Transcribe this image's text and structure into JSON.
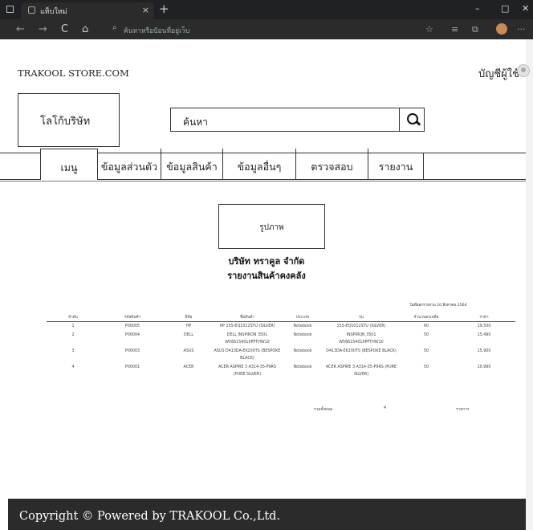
{
  "browser": {
    "tab_title": "แท็บใหม่",
    "tab_close": "×",
    "new_tab": "+",
    "address_placeholder": "ค้นหาหรือป้อนที่อยู่เว็บ",
    "controls": {
      "minimize": "–",
      "maximize": "□",
      "close": "✕"
    },
    "nav": {
      "back": "←",
      "forward": "→",
      "reload": "C",
      "home": "⌂"
    }
  },
  "header": {
    "store_name": "TRAKOOL STORE.COM",
    "account_label": "บัญชีผู้ใช้"
  },
  "logo_placeholder": "โลโก้บริษัท",
  "search": {
    "placeholder": "ค้นหา"
  },
  "menu": [
    "เมนู",
    "ข้อมูลส่วนตัว",
    "ข้อมูลสินค้า",
    "ข้อมูลอื่นๆ",
    "ตรวจสอบ",
    "รายงาน"
  ],
  "report": {
    "image_placeholder": "รูปภาพ",
    "company": "บริษัท ทราคูล จำกัด",
    "title": "รายงานสินค้าคงคลัง",
    "print_date": "วันที่ออกรายงาน 10 สิงหาคม 2564",
    "columns": [
      "ลำดับ",
      "รหัสสินค้า",
      "ยี่ห้อ",
      "ชื่อสินค้า",
      "ประเภท",
      "รุ่น",
      "จำนวนคงเหลือ",
      "ราคา"
    ],
    "rows": [
      [
        "1",
        "P00005",
        "HP",
        "HP 15S-EQ1012STU (SILVER)",
        "Notebook",
        "15S-EQ1012STU (SILVER)",
        "60",
        "19,500"
      ],
      [
        "2",
        "P00004",
        "DELL",
        "DELL INSPIRON 3501 W566154010PPTHW10",
        "Notebook",
        "INSPIRON 3501 W566154010PPTHW10",
        "50",
        "15,490"
      ],
      [
        "3",
        "P00003",
        "ASUS",
        "ASUS D413DA-EK200TS (BESPOKE BLACK)",
        "Notebook",
        "D413DA-EK200TS (BESPOKE BLACK)",
        "50",
        "15,900"
      ],
      [
        "4",
        "P00001",
        "ACER",
        "ACER ASPIRE 3 A314-35-P9RS (PURE SILVER)",
        "Notebook",
        "ACER ASPIRE 3 A314-35-P9RS (PURE SILVER)",
        "50",
        "10,990"
      ]
    ],
    "summary": {
      "label": "รวมทั้งหมด",
      "count": "4",
      "unit": "รายการ"
    }
  },
  "footer": {
    "copyright": "Copyright © Powered by TRAKOOL Co.,Ltd."
  }
}
